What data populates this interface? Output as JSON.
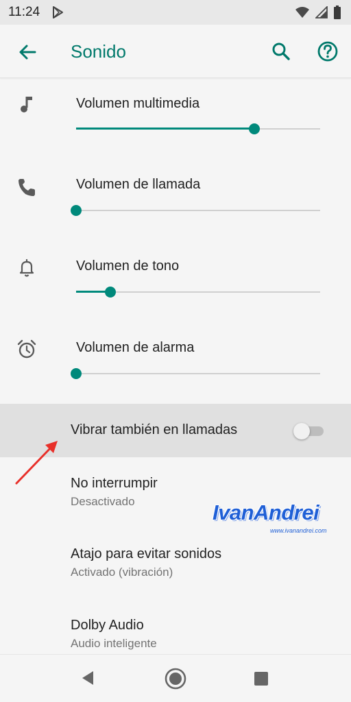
{
  "status_bar": {
    "time": "11:24",
    "icons": [
      "play-store-icon",
      "wifi-icon",
      "signal-icon",
      "battery-icon"
    ]
  },
  "app_bar": {
    "title": "Sonido",
    "icons": [
      "back-arrow-icon",
      "search-icon",
      "help-icon"
    ]
  },
  "volumes": [
    {
      "label": "Volumen multimedia",
      "icon": "music-note-icon",
      "level": 0.73
    },
    {
      "label": "Volumen de llamada",
      "icon": "phone-icon",
      "level": 0.0
    },
    {
      "label": "Volumen de tono",
      "icon": "bell-icon",
      "level": 0.14
    },
    {
      "label": "Volumen de alarma",
      "icon": "alarm-clock-icon",
      "level": 0.0
    }
  ],
  "vibrate": {
    "label": "Vibrar también en llamadas",
    "enabled": false
  },
  "preferences": [
    {
      "title": "No interrumpir",
      "summary": "Desactivado"
    },
    {
      "title": "Atajo para evitar sonidos",
      "summary": "Activado (vibración)"
    },
    {
      "title": "Dolby Audio",
      "summary": "Audio inteligente"
    }
  ],
  "watermark": {
    "brand": "IvanAndrei",
    "url": "www.ivanandrei.com"
  },
  "nav_bar": {
    "icons": [
      "nav-back-icon",
      "nav-home-icon",
      "nav-recents-icon"
    ]
  },
  "colors": {
    "accent": "#00796b",
    "slider": "#00897b",
    "annotation_arrow": "#e8302a"
  }
}
